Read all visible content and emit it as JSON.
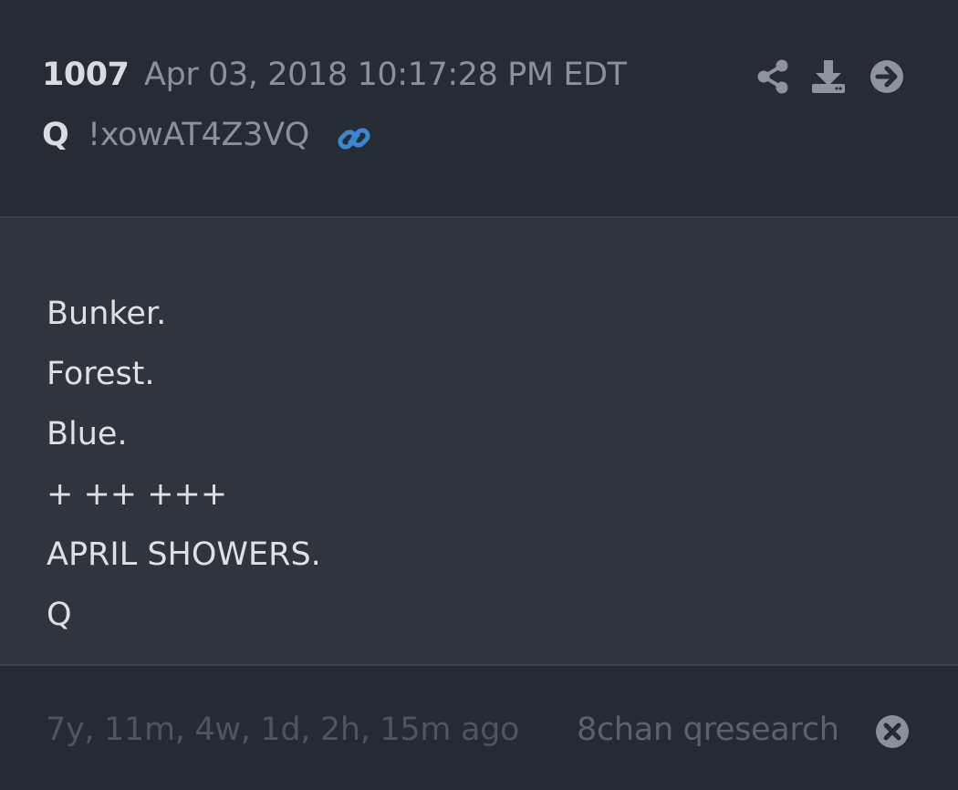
{
  "post": {
    "number": "1007",
    "date": "Apr 03, 2018 10:17:28 PM EDT",
    "author": "Q",
    "tripcode": "!xowAT4Z3VQ",
    "lines": [
      "Bunker.",
      "Forest.",
      "Blue.",
      "+ ++ +++",
      "APRIL SHOWERS.",
      "Q"
    ]
  },
  "actions": {
    "share_icon": "share-icon",
    "download_icon": "download-icon",
    "goto_icon": "arrow-right-circle-icon",
    "link_icon": "link-icon",
    "close_icon": "close-circle-icon"
  },
  "footer": {
    "ago": "7y, 11m, 4w, 1d, 2h, 15m ago",
    "source": "8chan qresearch"
  },
  "colors": {
    "background": "#262a32",
    "body_background": "#2f343d",
    "link_blue": "#3c86cf",
    "icon_gray": "#8e939d",
    "footer_icon": "#8a8f99"
  }
}
